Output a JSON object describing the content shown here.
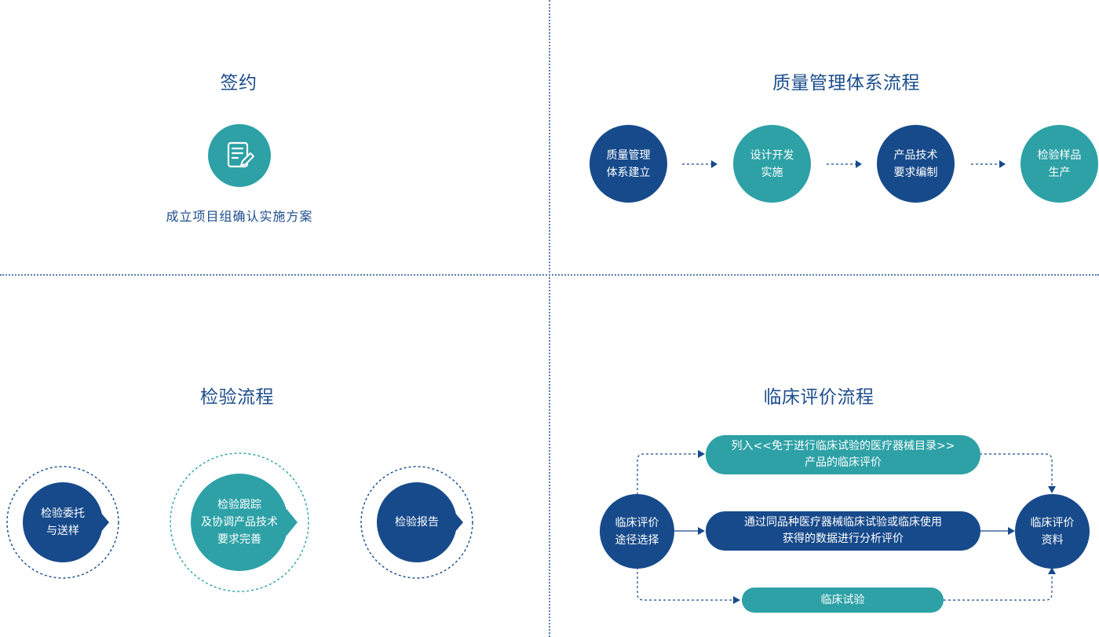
{
  "contract": {
    "title": "签约",
    "icon": "document-edit-icon",
    "caption": "成立项目组确认实施方案"
  },
  "quality": {
    "title": "质量管理体系流程",
    "steps": [
      {
        "line1": "质量管理",
        "line2": "体系建立"
      },
      {
        "line1": "设计开发",
        "line2": "实施"
      },
      {
        "line1": "产品技术",
        "line2": "要求编制"
      },
      {
        "line1": "检验样品",
        "line2": "生产"
      }
    ]
  },
  "inspection": {
    "title": "检验流程",
    "steps": [
      {
        "line1": "检验委托",
        "line2": "与送样"
      },
      {
        "line1": "检验跟踪",
        "line2": "及协调产品技术",
        "line3": "要求完善"
      },
      {
        "line1": "检验报告"
      }
    ]
  },
  "clinical": {
    "title": "临床评价流程",
    "start": {
      "line1": "临床评价",
      "line2": "途径选择"
    },
    "end": {
      "line1": "临床评价",
      "line2": "资料"
    },
    "paths": [
      {
        "line1": "列入<<免于进行临床试验的医疗器械目录>>",
        "line2": "产品的临床评价"
      },
      {
        "line1": "通过同品种医疗器械临床试验或临床使用",
        "line2": "获得的数据进行分析评价"
      },
      {
        "line1": "临床试验"
      }
    ]
  },
  "colors": {
    "navy": "#174a8b",
    "teal": "#2da1a6",
    "title": "#1c4d8c",
    "divider": "#5b7fb2"
  }
}
